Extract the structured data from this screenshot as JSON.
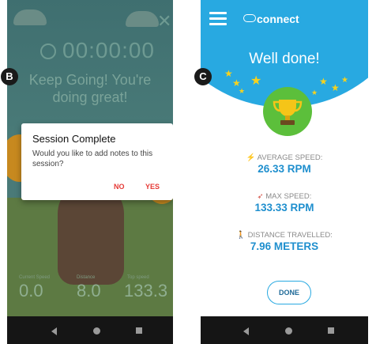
{
  "badges": {
    "left": "B",
    "right": "C"
  },
  "left_screen": {
    "timer": "00:00:00",
    "message": "Keep Going! You're doing great!",
    "dialog": {
      "title": "Session Complete",
      "body": "Would you like to add notes to this session?",
      "no_label": "NO",
      "yes_label": "YES"
    },
    "stats": [
      {
        "label": "Current Speed",
        "value": "0.0"
      },
      {
        "label": "Distance",
        "value": "8.0"
      },
      {
        "label": "Top speed",
        "value": "133.3"
      }
    ],
    "icons": [
      "close-icon",
      "stopwatch-icon"
    ]
  },
  "right_screen": {
    "brand": "connect",
    "heading": "Well done!",
    "stats": [
      {
        "icon": "lightning-icon",
        "label": "AVERAGE SPEED:",
        "value": "26.33 RPM"
      },
      {
        "icon": "rocket-icon",
        "label": "MAX SPEED:",
        "value": "133.33 RPM"
      },
      {
        "icon": "walker-icon",
        "label": "DISTANCE TRAVELLED:",
        "value": "7.96 METERS"
      }
    ],
    "done_label": "DONE",
    "icons": [
      "menu-icon",
      "trophy-icon"
    ]
  },
  "colors": {
    "accent_blue": "#28a9e1",
    "danger_red": "#e53935",
    "trophy_green": "#5cbf3b",
    "star_yellow": "#f7d21d"
  }
}
